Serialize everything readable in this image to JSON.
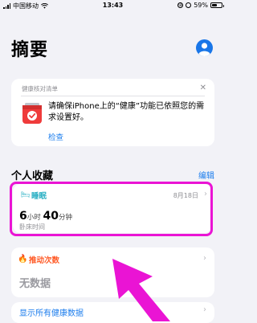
{
  "status_bar": {
    "carrier": "中国移动",
    "time": "13:43",
    "battery_percent": "59%",
    "battery_level": 0.59
  },
  "header": {
    "title": "摘要"
  },
  "health_checklist": {
    "heading": "健康核对清单",
    "message": "请确保iPhone上的“健康”功能已依照您的需求设置好。",
    "link": "检查"
  },
  "favorites": {
    "title": "个人收藏",
    "edit": "编辑"
  },
  "sleep_card": {
    "label": "睡眠",
    "date": "8月18日",
    "hours": "6",
    "hours_unit": "小时",
    "minutes": "40",
    "minutes_unit": "分钟",
    "caption": "卧床时间"
  },
  "steps_card": {
    "label": "推动次数",
    "empty_text": "无数据"
  },
  "show_all": {
    "label": "显示所有健康数据"
  },
  "colors": {
    "accent_blue": "#1c7ded",
    "sleep_teal": "#2ab0c4",
    "activity_orange": "#ff5a26",
    "highlight_pink": "#ea14d4"
  }
}
